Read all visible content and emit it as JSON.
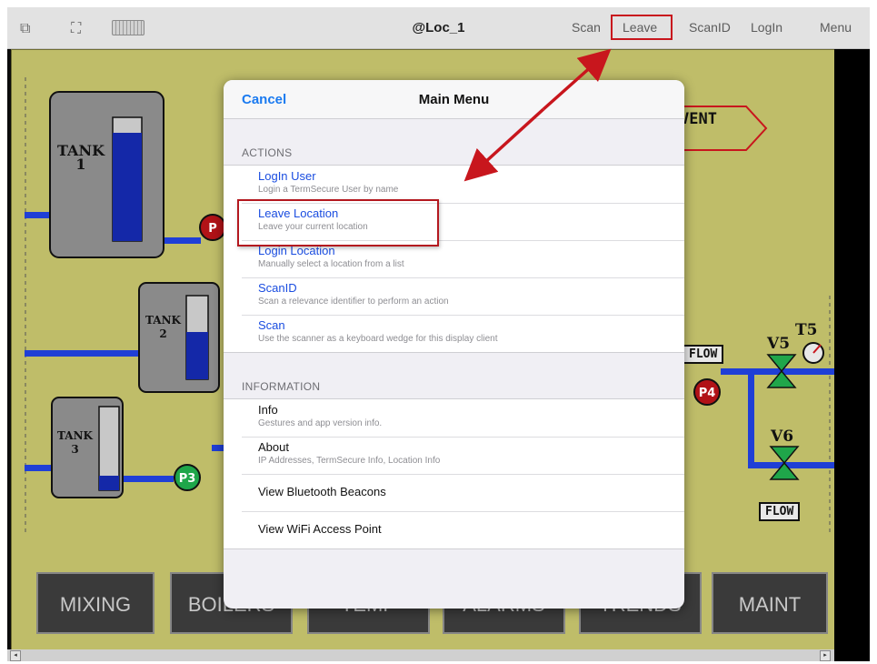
{
  "topbar": {
    "title": "@Loc_1",
    "icons": [
      "window-icon",
      "fullscreen-icon",
      "keyboard-icon"
    ],
    "actions": [
      "Scan",
      "Leave",
      "ScanID",
      "LogIn",
      "Menu"
    ]
  },
  "scada": {
    "tanks": [
      {
        "label": "TANK\n1",
        "level": 0.8
      },
      {
        "label": "TANK\n2",
        "level": 0.58
      },
      {
        "label": "TANK\n3",
        "level": 0.25
      }
    ],
    "pumps": [
      "P",
      "P3",
      "P4"
    ],
    "valves": [
      "V5",
      "V6"
    ],
    "gauge": "T5",
    "flow_labels": [
      "FLOW",
      "FLOW"
    ],
    "vent_label": "VENT",
    "nav_buttons": [
      "MIXING",
      "BOILERS",
      "TEMP",
      "ALARMS",
      "TRENDS",
      "MAINT"
    ]
  },
  "modal": {
    "cancel": "Cancel",
    "title": "Main Menu",
    "sections": [
      {
        "header": "ACTIONS",
        "items": [
          {
            "title": "LogIn User",
            "subtitle": "Login a TermSecure User by name"
          },
          {
            "title": "Leave Location",
            "subtitle": "Leave your current location"
          },
          {
            "title": "Login Location",
            "subtitle": "Manually select a location from a list"
          },
          {
            "title": "ScanID",
            "subtitle": "Scan a relevance identifier to perform an action"
          },
          {
            "title": "Scan",
            "subtitle": "Use the scanner as a keyboard wedge for this display client"
          }
        ]
      },
      {
        "header": "INFORMATION",
        "items": [
          {
            "title": "Info",
            "subtitle": "Gestures and app version info."
          },
          {
            "title": "About",
            "subtitle": "IP Addresses, TermSecure Info, Location Info"
          },
          {
            "title": "View Bluetooth Beacons",
            "subtitle": ""
          },
          {
            "title": "View WiFi Access Point",
            "subtitle": ""
          }
        ]
      }
    ]
  },
  "colors": {
    "annotation_red": "#c8161d",
    "ios_blue": "#1a7af0",
    "panel_background": "#bfbd69",
    "pipe_blue": "#1f3fd6"
  }
}
